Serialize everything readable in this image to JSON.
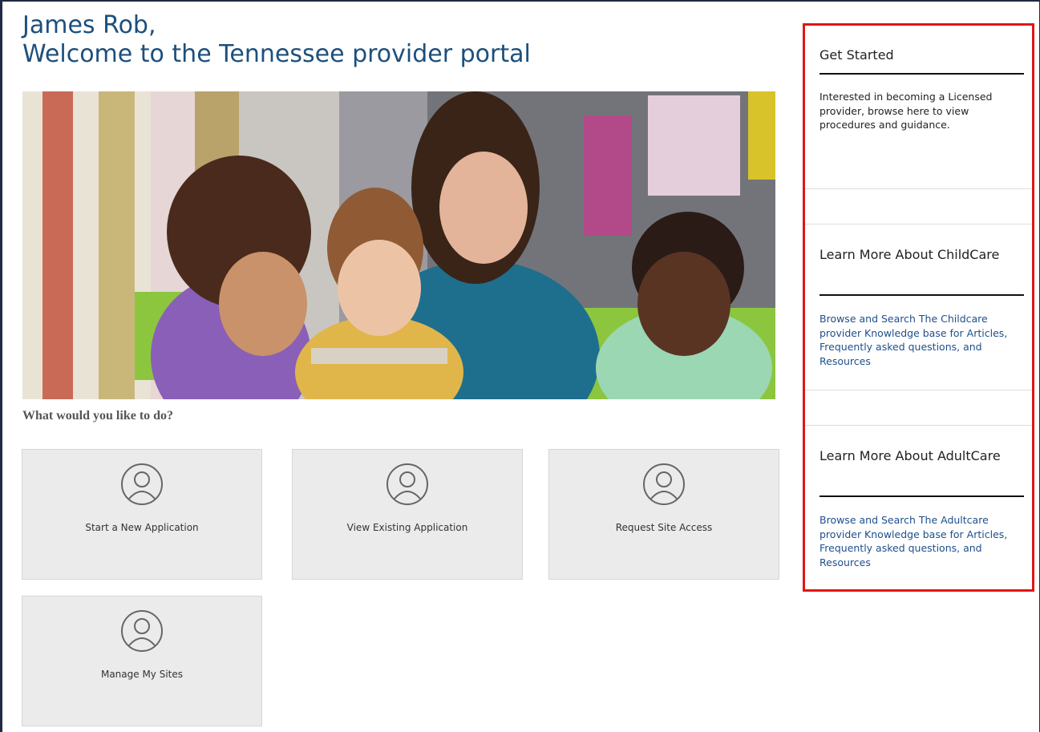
{
  "header": {
    "greeting_name": "James Rob,",
    "greeting_welcome": "Welcome to the Tennessee provider portal"
  },
  "main": {
    "prompt": "What would you like to do?",
    "actions": [
      {
        "label": "Start a New Application",
        "icon": "user-icon"
      },
      {
        "label": "View Existing Application",
        "icon": "user-icon"
      },
      {
        "label": "Request Site Access",
        "icon": "user-icon"
      },
      {
        "label": "Manage My Sites",
        "icon": "user-icon"
      }
    ]
  },
  "sidebar": {
    "sections": [
      {
        "title": "Get Started",
        "description": "Interested in becoming a Licensed provider, browse here to view procedures and guidance."
      },
      {
        "title": "Learn More About ChildCare",
        "description": "Browse and Search The Childcare provider Knowledge base for Articles, Frequently asked questions, and Resources"
      },
      {
        "title": "Learn More About AdultCare",
        "description": "Browse and Search The Adultcare provider Knowledge base for Articles, Frequently asked questions, and Resources"
      }
    ]
  },
  "colors": {
    "heading": "#1d4f7c",
    "link": "#1d4f8c",
    "highlight_border": "#e01616",
    "tile_bg": "#ebebeb"
  }
}
